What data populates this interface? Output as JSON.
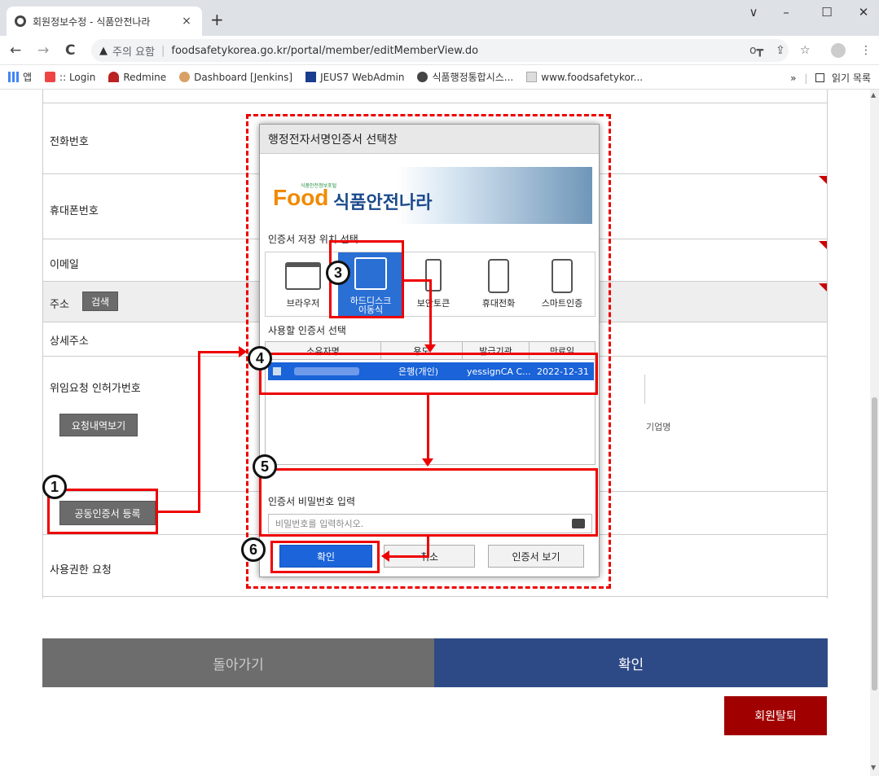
{
  "browser": {
    "tab_title": "회원정보수정 - 식품안전나라",
    "tab_close": "×",
    "new_tab": "+",
    "window_minimize": "–",
    "window_maximize": "☐",
    "window_close": "✕",
    "tab_menu": "∨",
    "back": "←",
    "forward": "→",
    "reload": "C",
    "security_warning_icon": "▲",
    "security_warning": "주의 요함",
    "url": "foodsafetykorea.go.kr/portal/member/editMemberView.do",
    "key_icon": "o┳",
    "share_icon": "⇪",
    "star_icon": "☆",
    "menu_icon": "⋮"
  },
  "bookmarks": {
    "apps_label": "앱",
    "items": [
      {
        "label": ":: Login"
      },
      {
        "label": "Redmine"
      },
      {
        "label": "Dashboard [Jenkins]"
      },
      {
        "label": "JEUS7 WebAdmin"
      },
      {
        "label": "식품행정통합시스..."
      },
      {
        "label": "www.foodsafetykor..."
      }
    ],
    "more": "»",
    "reading_list": "읽기 목록"
  },
  "form": {
    "phone_label": "전화번호",
    "mobile_label": "휴대폰번호",
    "email_label": "이메일",
    "address_label": "주소",
    "search_button": "검색",
    "address_detail_label": "상세주소",
    "delegation_label": "위임요청 인허가번호",
    "request_history_button": "요청내역보기",
    "company_name_label": "기업명",
    "cert_register_button": "공동인증서 등록",
    "usage_request_label": "사용권한 요청"
  },
  "footer": {
    "back_button": "돌아가기",
    "confirm_button": "확인",
    "withdraw_button": "회원탈퇴"
  },
  "modal": {
    "title": "행정전자서명인증서 선택창",
    "logo_food": "Food",
    "logo_small": "식품안전정보포털",
    "logo_kr": "식품안전나라",
    "storage_title": "인증서 저장 위치 선택",
    "locations": [
      {
        "label": "브라우저"
      },
      {
        "label": "하드디스크\n이동식"
      },
      {
        "label": "보안토큰"
      },
      {
        "label": "휴대전화"
      },
      {
        "label": "스마트인증"
      }
    ],
    "cert_select_title": "사용할 인증서 선택",
    "table_headers": [
      "소유자명",
      "용도",
      "발급기관",
      "만료일"
    ],
    "cert_row": {
      "purpose": "은행(개인)",
      "issuer": "yessignCA C...",
      "expiry": "2022-12-31"
    },
    "password_title": "인증서 비밀번호 입력",
    "password_placeholder": "비밀번호를 입력하시오.",
    "ok_button": "확인",
    "cancel_button": "취소",
    "view_cert_button": "인증서 보기"
  },
  "annotations": {
    "step1": "1",
    "step3": "3",
    "step4": "4",
    "step5": "5",
    "step6": "6"
  }
}
